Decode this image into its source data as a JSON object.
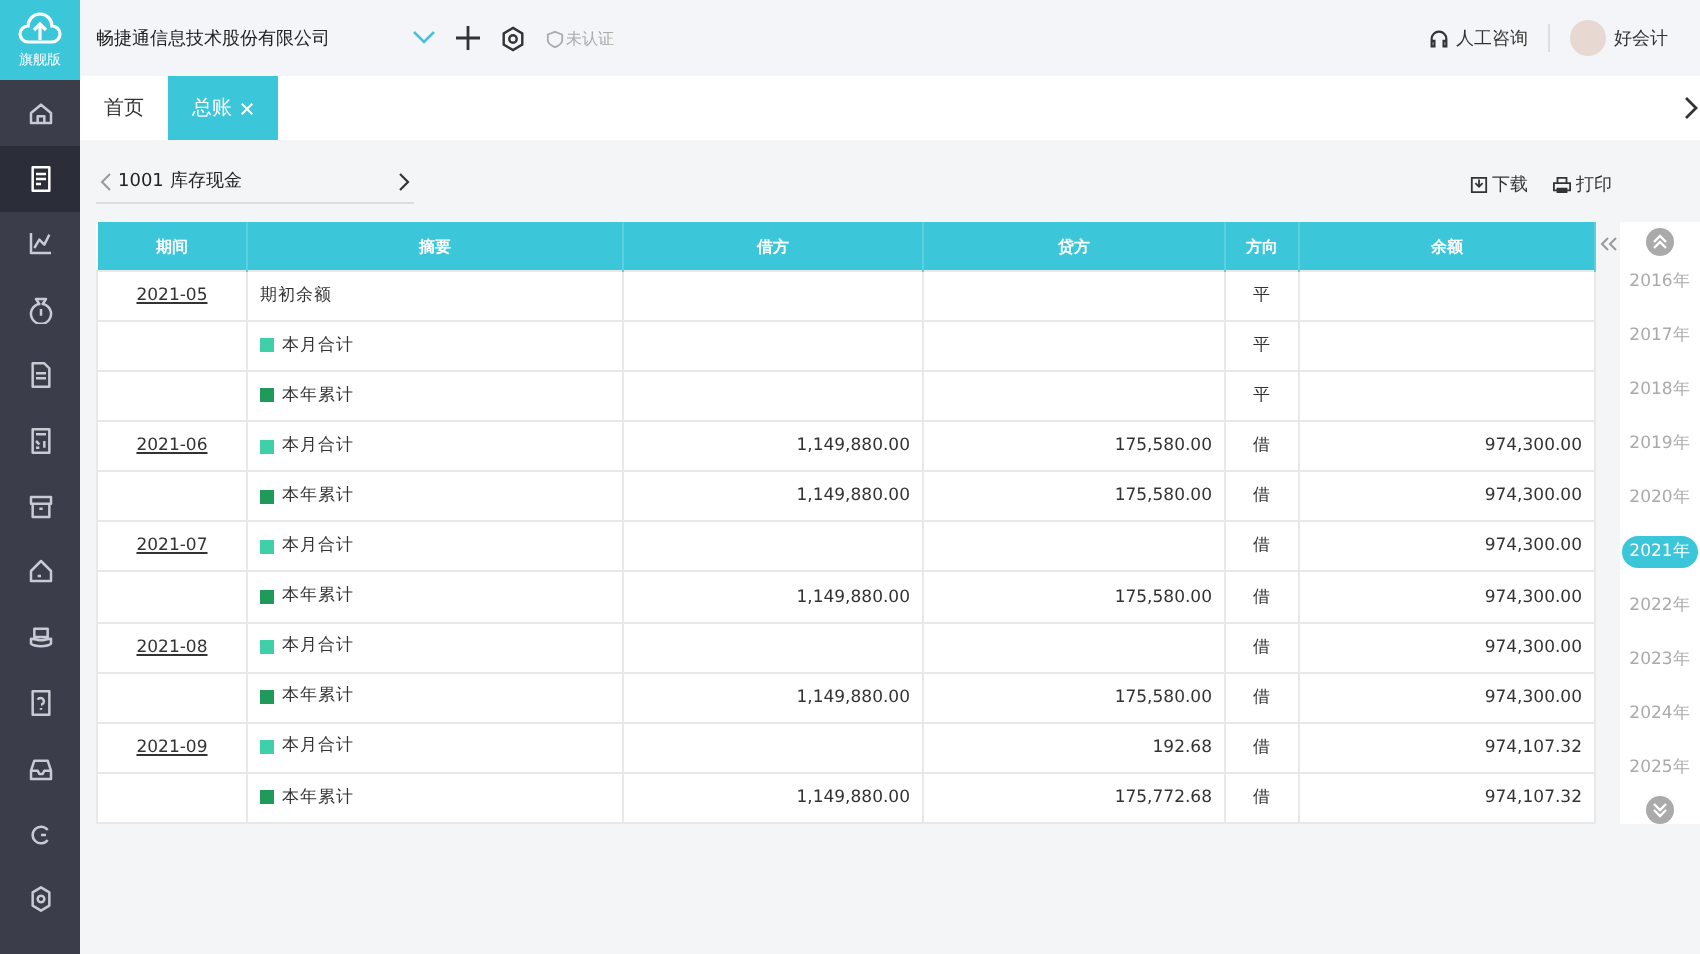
{
  "brand": {
    "label": "旗舰版"
  },
  "sidebar": {
    "items": [
      {
        "selected": false
      },
      {
        "selected": true
      },
      {
        "selected": false
      },
      {
        "selected": false
      },
      {
        "selected": false
      },
      {
        "selected": false
      },
      {
        "selected": false
      },
      {
        "selected": false
      },
      {
        "selected": false
      },
      {
        "selected": false
      },
      {
        "selected": false
      },
      {
        "selected": false
      },
      {
        "selected": false
      }
    ]
  },
  "header": {
    "company": "畅捷通信息技术股份有限公司",
    "certification": "未认证",
    "support": "人工咨询",
    "user": "好会计"
  },
  "tabs": [
    {
      "label": "首页",
      "selected": false,
      "closable": false
    },
    {
      "label": "总账",
      "selected": true,
      "closable": true
    }
  ],
  "toolbar": {
    "account": "1001 库存现金",
    "download": "下载",
    "print": "打印"
  },
  "table": {
    "columns": [
      "期间",
      "摘要",
      "借方",
      "贷方",
      "方向",
      "余额"
    ],
    "rows": [
      {
        "period": "2021-05",
        "summary": "期初余额",
        "kind": "opening",
        "debit": "",
        "credit": "",
        "direction": "平",
        "balance": ""
      },
      {
        "period": "",
        "summary": "本月合计",
        "kind": "month",
        "debit": "",
        "credit": "",
        "direction": "平",
        "balance": ""
      },
      {
        "period": "",
        "summary": "本年累计",
        "kind": "year",
        "debit": "",
        "credit": "",
        "direction": "平",
        "balance": ""
      },
      {
        "period": "2021-06",
        "summary": "本月合计",
        "kind": "month",
        "debit": "1,149,880.00",
        "credit": "175,580.00",
        "direction": "借",
        "balance": "974,300.00"
      },
      {
        "period": "",
        "summary": "本年累计",
        "kind": "year",
        "debit": "1,149,880.00",
        "credit": "175,580.00",
        "direction": "借",
        "balance": "974,300.00"
      },
      {
        "period": "2021-07",
        "summary": "本月合计",
        "kind": "month",
        "debit": "",
        "credit": "",
        "direction": "借",
        "balance": "974,300.00"
      },
      {
        "period": "",
        "summary": "本年累计",
        "kind": "year",
        "debit": "1,149,880.00",
        "credit": "175,580.00",
        "direction": "借",
        "balance": "974,300.00"
      },
      {
        "period": "2021-08",
        "summary": "本月合计",
        "kind": "month",
        "debit": "",
        "credit": "",
        "direction": "借",
        "balance": "974,300.00"
      },
      {
        "period": "",
        "summary": "本年累计",
        "kind": "year",
        "debit": "1,149,880.00",
        "credit": "175,580.00",
        "direction": "借",
        "balance": "974,300.00"
      },
      {
        "period": "2021-09",
        "summary": "本月合计",
        "kind": "month",
        "debit": "",
        "credit": "192.68",
        "direction": "借",
        "balance": "974,107.32"
      },
      {
        "period": "",
        "summary": "本年累计",
        "kind": "year",
        "debit": "1,149,880.00",
        "credit": "175,772.68",
        "direction": "借",
        "balance": "974,107.32"
      }
    ]
  },
  "years": [
    {
      "label": "2016年",
      "selected": false
    },
    {
      "label": "2017年",
      "selected": false
    },
    {
      "label": "2018年",
      "selected": false
    },
    {
      "label": "2019年",
      "selected": false
    },
    {
      "label": "2020年",
      "selected": false
    },
    {
      "label": "2021年",
      "selected": true
    },
    {
      "label": "2022年",
      "selected": false
    },
    {
      "label": "2023年",
      "selected": false
    },
    {
      "label": "2024年",
      "selected": false
    },
    {
      "label": "2025年",
      "selected": false
    }
  ]
}
